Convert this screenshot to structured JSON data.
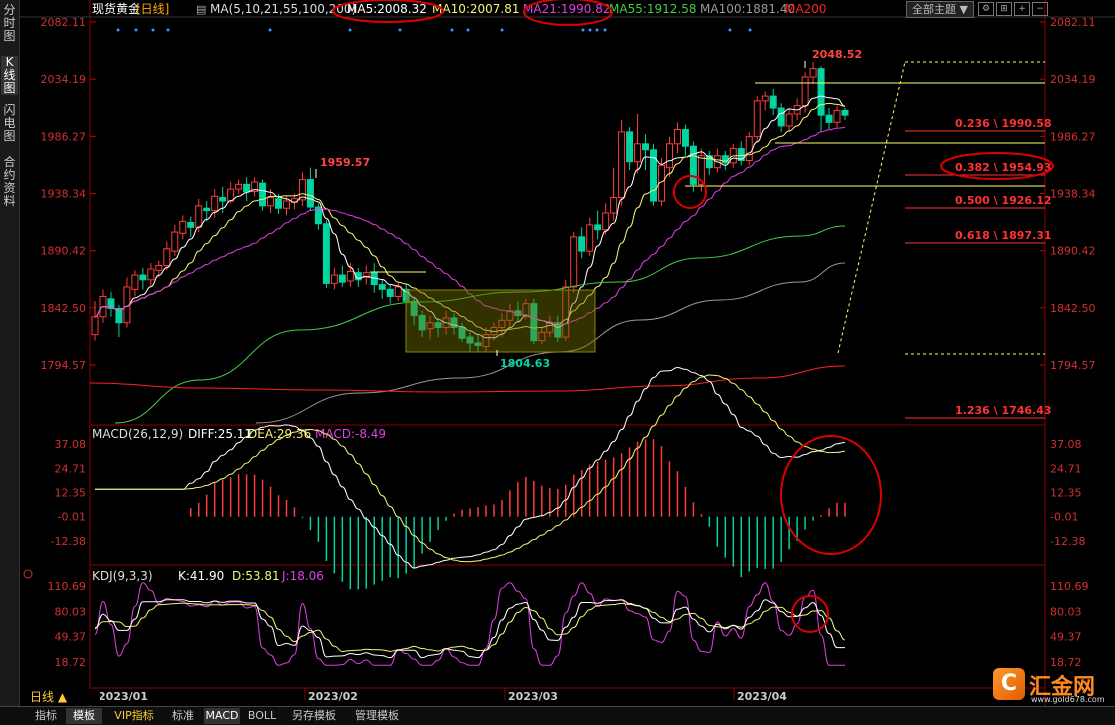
{
  "sidebar": {
    "items": [
      {
        "label": "分时图",
        "active": false
      },
      {
        "label": "K线图",
        "active": true
      },
      {
        "label": "闪电图",
        "active": false
      },
      {
        "label": "合约资料",
        "active": false
      }
    ]
  },
  "toolbar": {
    "theme_button": "全部主题",
    "theme_arrow": "▼",
    "icons": [
      "⚙",
      "⊞",
      "+",
      "−"
    ]
  },
  "bottom_bar": {
    "period": "日线 ▲",
    "tabs": [
      {
        "label": "指标",
        "active": false
      },
      {
        "label": "模板",
        "active": true
      },
      {
        "label": "VIP指标",
        "active": false,
        "color": "#ffcc33"
      },
      {
        "label": "标准",
        "active": false
      },
      {
        "label": "MACD",
        "active": true
      },
      {
        "label": "BOLL",
        "active": false
      },
      {
        "label": "另存模板",
        "active": false
      },
      {
        "label": "管理模板",
        "active": false
      }
    ]
  },
  "logo": {
    "mark": "C",
    "name": "汇金网",
    "url": "www.gold678.com"
  },
  "colors": {
    "up": "#ff3b3b",
    "down": "#00d4a0",
    "ma5": "#ffffff",
    "ma10": "#f5f577",
    "ma21": "#e040e0",
    "ma55": "#44cc44",
    "ma100": "#999999",
    "ma200": "#ff2020",
    "fib": "#ff3333",
    "yellow": "#ffff66",
    "annot": "#dd0000",
    "axis": "#c80000"
  },
  "chart_data": [
    {
      "panel": "price",
      "type": "candlestick",
      "instrument": "现货黄金",
      "period": "[日线]",
      "indicator_label": "MA(5,10,21,55,100,200)",
      "ma_values": [
        {
          "label": "MA5:2008.32",
          "color": "#ffffff"
        },
        {
          "label": "MA10:2007.81",
          "color": "#f5f577"
        },
        {
          "label": "MA21:1990.82",
          "color": "#e040e0"
        },
        {
          "label": "MA55:1912.58",
          "color": "#44cc44"
        },
        {
          "label": "MA100:1881.40",
          "color": "#999999"
        },
        {
          "label": "MA200",
          "color": "#ff2020"
        }
      ],
      "y_ticks": [
        "2082.11",
        "2034.19",
        "1986.27",
        "1938.34",
        "1890.42",
        "1842.50",
        "1794.57"
      ],
      "ylim": [
        1746.43,
        2082.11
      ],
      "x_ticks": [
        "2023/01",
        "2023/02",
        "2023/03",
        "2023/04"
      ],
      "high_label": "2048.52",
      "peak_feb_label": "1959.57",
      "low_label": "1804.63",
      "fib_levels": [
        {
          "label": "0.236 \\ 1990.58",
          "value": 1990.58
        },
        {
          "label": "0.382 \\ 1954.93",
          "value": 1954.93
        },
        {
          "label": "0.500 \\ 1926.12",
          "value": 1926.12
        },
        {
          "label": "0.618 \\ 1897.31",
          "value": 1897.31
        },
        {
          "label": "1.236 \\ 1746.43",
          "value": 1746.43
        }
      ],
      "candles": [
        [
          1820,
          1835,
          1815,
          1848
        ],
        [
          1835,
          1852,
          1830,
          1858
        ],
        [
          1850,
          1842,
          1835,
          1856
        ],
        [
          1842,
          1830,
          1818,
          1845
        ],
        [
          1830,
          1860,
          1826,
          1868
        ],
        [
          1858,
          1870,
          1852,
          1874
        ],
        [
          1870,
          1866,
          1858,
          1876
        ],
        [
          1866,
          1875,
          1860,
          1880
        ],
        [
          1874,
          1878,
          1868,
          1882
        ],
        [
          1878,
          1892,
          1874,
          1898
        ],
        [
          1890,
          1906,
          1886,
          1912
        ],
        [
          1905,
          1915,
          1900,
          1920
        ],
        [
          1914,
          1910,
          1902,
          1919
        ],
        [
          1910,
          1928,
          1906,
          1934
        ],
        [
          1926,
          1924,
          1915,
          1932
        ],
        [
          1924,
          1936,
          1918,
          1942
        ],
        [
          1935,
          1932,
          1922,
          1944
        ],
        [
          1932,
          1942,
          1930,
          1948
        ],
        [
          1942,
          1946,
          1938,
          1950
        ],
        [
          1946,
          1940,
          1932,
          1952
        ],
        [
          1940,
          1948,
          1936,
          1952
        ],
        [
          1947,
          1928,
          1924,
          1950
        ],
        [
          1928,
          1935,
          1922,
          1942
        ],
        [
          1934,
          1926,
          1921,
          1938
        ],
        [
          1926,
          1932,
          1920,
          1936
        ],
        [
          1931,
          1934,
          1925,
          1938
        ],
        [
          1933,
          1950,
          1928,
          1956
        ],
        [
          1950,
          1927,
          1924,
          1960
        ],
        [
          1927,
          1913,
          1908,
          1930
        ],
        [
          1913,
          1863,
          1859,
          1916
        ],
        [
          1863,
          1870,
          1858,
          1876
        ],
        [
          1870,
          1864,
          1860,
          1878
        ],
        [
          1865,
          1873,
          1860,
          1880
        ],
        [
          1872,
          1866,
          1860,
          1876
        ],
        [
          1868,
          1872,
          1862,
          1878
        ],
        [
          1872,
          1862,
          1855,
          1880
        ],
        [
          1862,
          1858,
          1850,
          1866
        ],
        [
          1858,
          1852,
          1846,
          1862
        ],
        [
          1852,
          1860,
          1848,
          1864
        ],
        [
          1858,
          1848,
          1841,
          1862
        ],
        [
          1848,
          1836,
          1828,
          1852
        ],
        [
          1836,
          1824,
          1818,
          1840
        ],
        [
          1825,
          1830,
          1816,
          1836
        ],
        [
          1830,
          1826,
          1818,
          1834
        ],
        [
          1826,
          1834,
          1820,
          1840
        ],
        [
          1834,
          1826,
          1820,
          1838
        ],
        [
          1826,
          1817,
          1814,
          1830
        ],
        [
          1818,
          1813,
          1806,
          1822
        ],
        [
          1813,
          1811,
          1805,
          1820
        ],
        [
          1810,
          1820,
          1806,
          1826
        ],
        [
          1820,
          1826,
          1815,
          1830
        ],
        [
          1826,
          1832,
          1818,
          1838
        ],
        [
          1832,
          1840,
          1826,
          1846
        ],
        [
          1840,
          1836,
          1830,
          1848
        ],
        [
          1836,
          1846,
          1833,
          1850
        ],
        [
          1846,
          1815,
          1812,
          1850
        ],
        [
          1815,
          1822,
          1812,
          1826
        ],
        [
          1822,
          1830,
          1818,
          1836
        ],
        [
          1830,
          1818,
          1814,
          1836
        ],
        [
          1818,
          1860,
          1815,
          1866
        ],
        [
          1860,
          1902,
          1855,
          1906
        ],
        [
          1902,
          1890,
          1884,
          1910
        ],
        [
          1890,
          1912,
          1886,
          1918
        ],
        [
          1912,
          1908,
          1900,
          1924
        ],
        [
          1908,
          1922,
          1904,
          1930
        ],
        [
          1922,
          1935,
          1916,
          1960
        ],
        [
          1935,
          1990,
          1928,
          2000
        ],
        [
          1990,
          1965,
          1958,
          1994
        ],
        [
          1965,
          1980,
          1955,
          2005
        ],
        [
          1980,
          1975,
          1958,
          1988
        ],
        [
          1975,
          1932,
          1928,
          1980
        ],
        [
          1932,
          1962,
          1928,
          1968
        ],
        [
          1960,
          1980,
          1952,
          1986
        ],
        [
          1980,
          1992,
          1972,
          1998
        ],
        [
          1992,
          1978,
          1970,
          1996
        ],
        [
          1978,
          1946,
          1940,
          1982
        ],
        [
          1946,
          1970,
          1940,
          1976
        ],
        [
          1970,
          1960,
          1954,
          1974
        ],
        [
          1960,
          1970,
          1956,
          1976
        ],
        [
          1970,
          1964,
          1958,
          1974
        ],
        [
          1964,
          1976,
          1960,
          1980
        ],
        [
          1976,
          1966,
          1962,
          1982
        ],
        [
          1966,
          1986,
          1962,
          1990
        ],
        [
          1986,
          2016,
          1982,
          2020
        ],
        [
          2016,
          2020,
          2008,
          2024
        ],
        [
          2020,
          2010,
          2004,
          2026
        ],
        [
          2010,
          1995,
          1990,
          2014
        ],
        [
          1995,
          2005,
          1990,
          2010
        ],
        [
          2005,
          2012,
          2000,
          2018
        ],
        [
          2012,
          2036,
          2006,
          2040
        ],
        [
          2036,
          2043,
          2030,
          2048.52
        ],
        [
          2043,
          2004,
          1990,
          2045
        ],
        [
          2004,
          1998,
          1992,
          2010
        ],
        [
          1998,
          2008,
          1994,
          2012
        ],
        [
          2008,
          2004,
          2000,
          2010
        ]
      ]
    },
    {
      "panel": "macd",
      "type": "line",
      "title": "MACD(26,12,9)",
      "values_text": [
        {
          "label": "DIFF:25.11",
          "color": "#ffffff"
        },
        {
          "label": "DEA:29.36",
          "color": "#f5f577"
        },
        {
          "label": "MACD:-8.49",
          "color": "#e040e0"
        }
      ],
      "y_ticks": [
        "37.08",
        "24.71",
        "12.35",
        "-0.01",
        "-12.38"
      ],
      "ylim": [
        -12.38,
        37.08
      ]
    },
    {
      "panel": "kdj",
      "type": "line",
      "title": "KDJ(9,3,3)",
      "values_text": [
        {
          "label": "K:41.90",
          "color": "#ffffff"
        },
        {
          "label": "D:53.81",
          "color": "#f5f577"
        },
        {
          "label": "J:18.06",
          "color": "#e040e0"
        }
      ],
      "y_ticks": [
        "110.69",
        "80.03",
        "49.37",
        "18.72"
      ],
      "ylim": [
        18.72,
        110.69
      ]
    }
  ]
}
